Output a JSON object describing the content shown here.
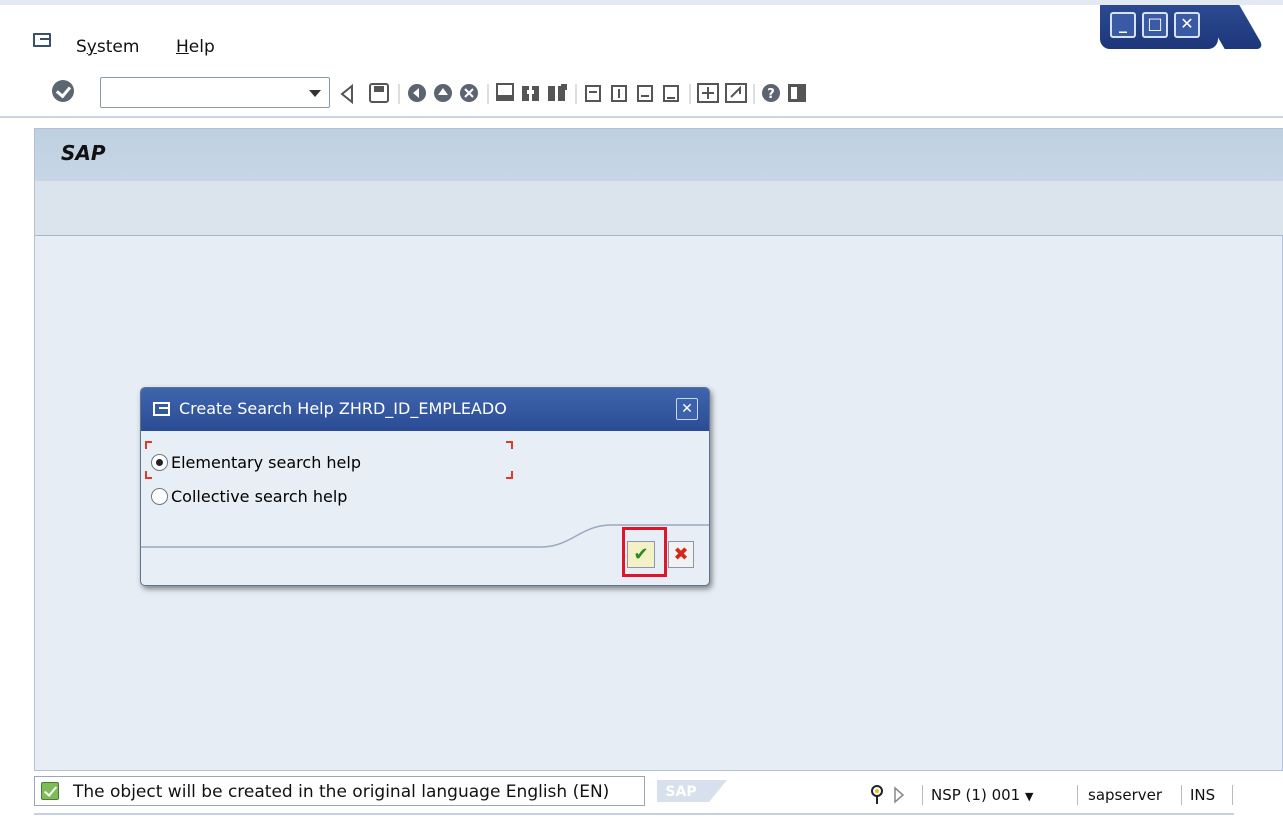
{
  "menubar": {
    "items": [
      {
        "label": "System",
        "accel": "y"
      },
      {
        "label": "Help",
        "accel": "H"
      }
    ]
  },
  "window_controls": {
    "minimize": "_",
    "maximize": "□",
    "close": "✕"
  },
  "toolbar": {
    "command_field": {
      "value": "",
      "placeholder": ""
    },
    "icons": [
      "enter-icon",
      "back-icon",
      "save-icon",
      "back-green-icon",
      "exit-icon",
      "cancel-icon",
      "print-icon",
      "find-icon",
      "find-next-icon",
      "first-page-icon",
      "previous-page-icon",
      "next-page-icon",
      "last-page-icon",
      "create-session-icon",
      "shortcut-icon",
      "help-icon",
      "layout-icon"
    ]
  },
  "screen": {
    "title": "SAP"
  },
  "dialog": {
    "title": "Create Search Help ZHRD_ID_EMPLEADO",
    "options": [
      {
        "label": "Elementary search help",
        "selected": true
      },
      {
        "label": "Collective search help",
        "selected": false
      }
    ],
    "ok_symbol": "✔",
    "cancel_symbol": "✖"
  },
  "status": {
    "message": "The object will be created in the original language English (EN)",
    "logo_text": "SAP",
    "system": "NSP (1) 001",
    "server": "sapserver",
    "mode": "INS"
  },
  "colors": {
    "dialog_title": "#2b4c95",
    "highlight": "#e0152a",
    "focus_marker": "#e03a2a"
  }
}
